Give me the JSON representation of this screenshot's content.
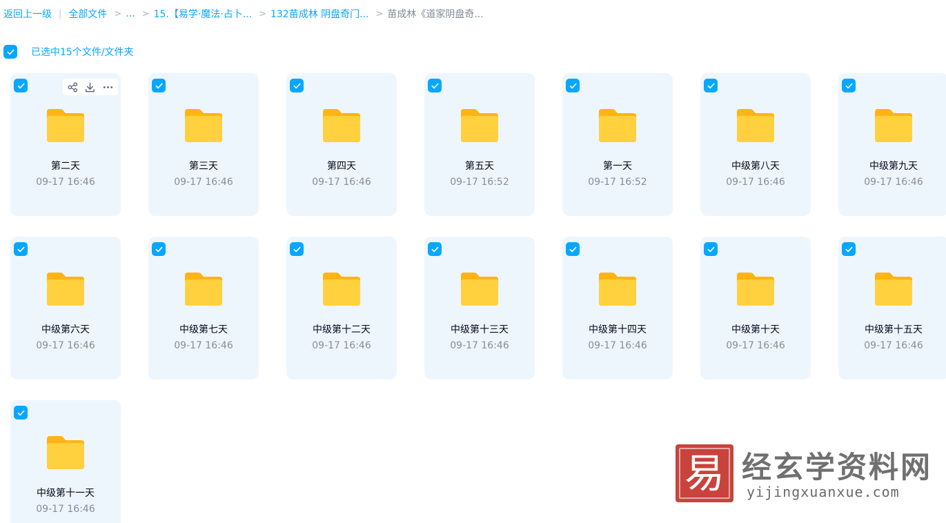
{
  "breadcrumb": {
    "back": "返回上一级",
    "root": "全部文件",
    "ellipsis": "...",
    "level1": "15.【易学·魔法·占卜...",
    "level2": "132苗成林 阴盘奇门...",
    "current": "苗成林《道家阴盘奇..."
  },
  "selection": {
    "label": "已选中15个文件/文件夹",
    "all_checked": true
  },
  "colors": {
    "accent": "#06a7ff",
    "card_bg": "#eef6fd",
    "folder": "#ffc523"
  },
  "icons": {
    "folder": "folder-icon",
    "check": "checkmark-icon",
    "share": "share-icon",
    "download": "download-icon",
    "more": "more-icon"
  },
  "items": [
    {
      "name": "第二天",
      "date": "09-17 16:46",
      "checked": true
    },
    {
      "name": "第三天",
      "date": "09-17 16:46",
      "checked": true
    },
    {
      "name": "第四天",
      "date": "09-17 16:46",
      "checked": true
    },
    {
      "name": "第五天",
      "date": "09-17 16:52",
      "checked": true
    },
    {
      "name": "第一天",
      "date": "09-17 16:52",
      "checked": true
    },
    {
      "name": "中级第八天",
      "date": "09-17 16:46",
      "checked": true
    },
    {
      "name": "中级第九天",
      "date": "09-17 16:46",
      "checked": true
    },
    {
      "name": "中级第六天",
      "date": "09-17 16:46",
      "checked": true
    },
    {
      "name": "中级第七天",
      "date": "09-17 16:46",
      "checked": true
    },
    {
      "name": "中级第十二天",
      "date": "09-17 16:46",
      "checked": true
    },
    {
      "name": "中级第十三天",
      "date": "09-17 16:46",
      "checked": true
    },
    {
      "name": "中级第十四天",
      "date": "09-17 16:46",
      "checked": true
    },
    {
      "name": "中级第十天",
      "date": "09-17 16:46",
      "checked": true
    },
    {
      "name": "中级第十五天",
      "date": "09-17 16:46",
      "checked": true
    },
    {
      "name": "中级第十一天",
      "date": "09-17 16:46",
      "checked": true
    }
  ],
  "watermark": {
    "seal_char": "易",
    "title": "经玄学资料网",
    "url": "yijingxuanxue.com"
  }
}
